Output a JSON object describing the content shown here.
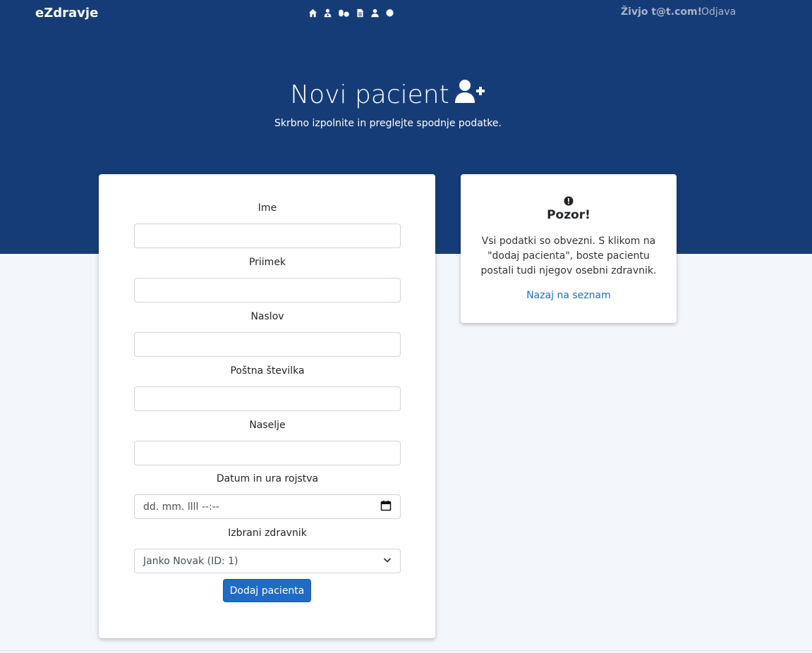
{
  "nav": {
    "brand": "eZdravje",
    "icons": [
      "home-icon",
      "doctor-icon",
      "pills-icon",
      "file-icon",
      "user-icon",
      "gear-icon"
    ],
    "greeting": "Živjo t@t.com!",
    "logout": "Odjava"
  },
  "hero": {
    "title": "Novi pacient",
    "subtitle": "Skrbno izpolnite in preglejte spodnje podatke.",
    "icon": "user-plus-icon"
  },
  "form": {
    "first_name": {
      "label": "Ime",
      "value": ""
    },
    "last_name": {
      "label": "Priimek",
      "value": ""
    },
    "address": {
      "label": "Naslov",
      "value": ""
    },
    "postal_code": {
      "label": "Poštna številka",
      "value": ""
    },
    "city": {
      "label": "Naselje",
      "value": ""
    },
    "birth": {
      "label": "Datum in ura rojstva",
      "placeholder": "dd. mm. llll --:--"
    },
    "doctor": {
      "label": "Izbrani zdravnik",
      "selected": "Janko Novak (ID: 1)"
    },
    "submit_label": "Dodaj pacienta"
  },
  "info": {
    "icon": "exclamation-circle-icon",
    "title": "Pozor!",
    "text": "Vsi podatki so obvezni. S klikom na \"dodaj pacienta\", boste pacientu postali tudi njegov osebni zdravnik.",
    "link": "Nazaj na seznam"
  },
  "colors": {
    "hero_bg": "#163c78",
    "page_bg": "#f3f6fa",
    "primary": "#1f6bc7"
  }
}
